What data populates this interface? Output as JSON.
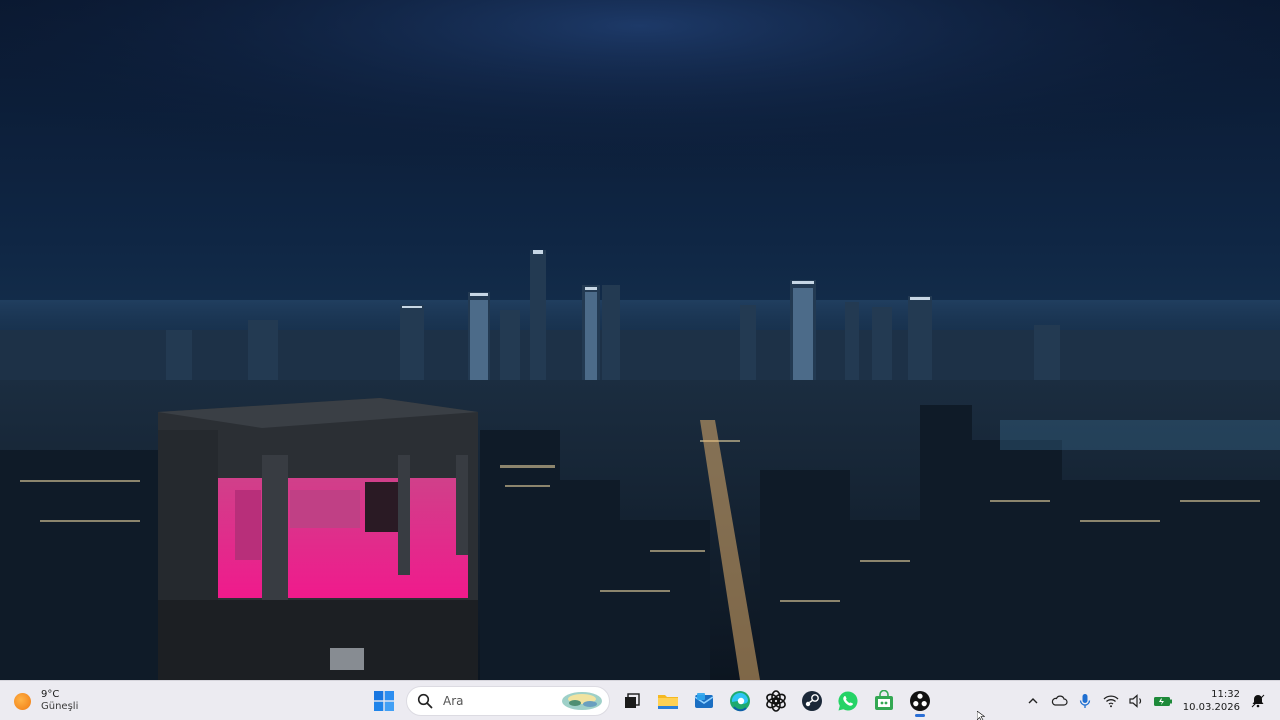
{
  "taskbar": {
    "weather": {
      "temperature": "9°C",
      "condition": "Güneşli",
      "icon": "sun-icon"
    },
    "search": {
      "label": "Ara",
      "icon": "search-icon"
    },
    "start": {
      "icon": "windows-start-icon"
    },
    "apps": [
      {
        "name": "task-view",
        "icon": "task-view-icon"
      },
      {
        "name": "file-explorer",
        "icon": "folder-icon"
      },
      {
        "name": "mail",
        "icon": "mail-icon"
      },
      {
        "name": "edge",
        "icon": "edge-icon"
      },
      {
        "name": "chatgpt",
        "icon": "chatgpt-icon"
      },
      {
        "name": "steam",
        "icon": "steam-icon"
      },
      {
        "name": "whatsapp",
        "icon": "whatsapp-icon"
      },
      {
        "name": "store",
        "icon": "store-bag-icon"
      },
      {
        "name": "obs",
        "icon": "obs-icon",
        "active": true
      }
    ],
    "tray": {
      "icons": [
        "chevron-up-icon",
        "cloud-icon",
        "microphone-icon",
        "wifi-icon",
        "volume-icon",
        "battery-icon"
      ],
      "clock": {
        "time": "11:32",
        "date": "10.03.2026"
      },
      "notification_icon": "notification-bell-icon"
    }
  },
  "colors": {
    "taskbar_bg": "#ecebf1",
    "accent": "#2a6fd6",
    "sky": "#0d1e3a"
  }
}
